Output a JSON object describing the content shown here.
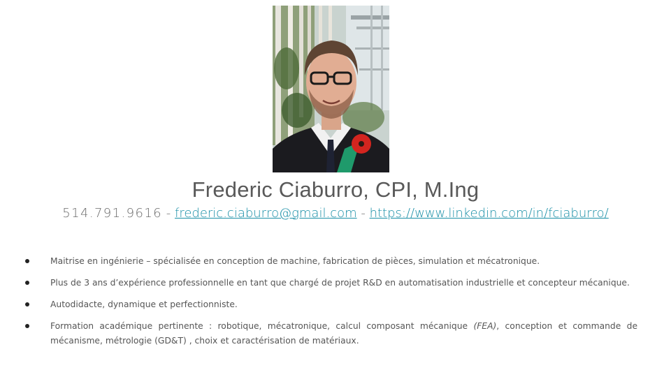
{
  "profile": {
    "photo_icon": "portrait-photo",
    "name": "Frederic Ciaburro, CPI, M.Ing",
    "phone": "514.791.9616",
    "sep1": " - ",
    "email": "frederic.ciaburro@gmail.com",
    "sep2": " - ",
    "linkedin": "https://www.linkedin.com/in/fciaburro/",
    "link_color": "#1a8fa7"
  },
  "bullets": [
    {
      "text": "Maitrise en ingénierie – spécialisée en conception de machine, fabrication de pièces, simulation et mécatronique."
    },
    {
      "text": "Plus de 3 ans d’expérience professionnelle en tant que chargé de projet R&D en automatisation industrielle et concepteur mécanique."
    },
    {
      "text": "Autodidacte, dynamique et perfectionniste."
    },
    {
      "pre": "Formation académique pertinente : robotique, mécatronique, calcul composant mécanique ",
      "em": "(FEA)",
      "post": ", conception et commande de mécanisme, métrologie (GD&T) , choix et caractérisation de matériaux."
    }
  ]
}
